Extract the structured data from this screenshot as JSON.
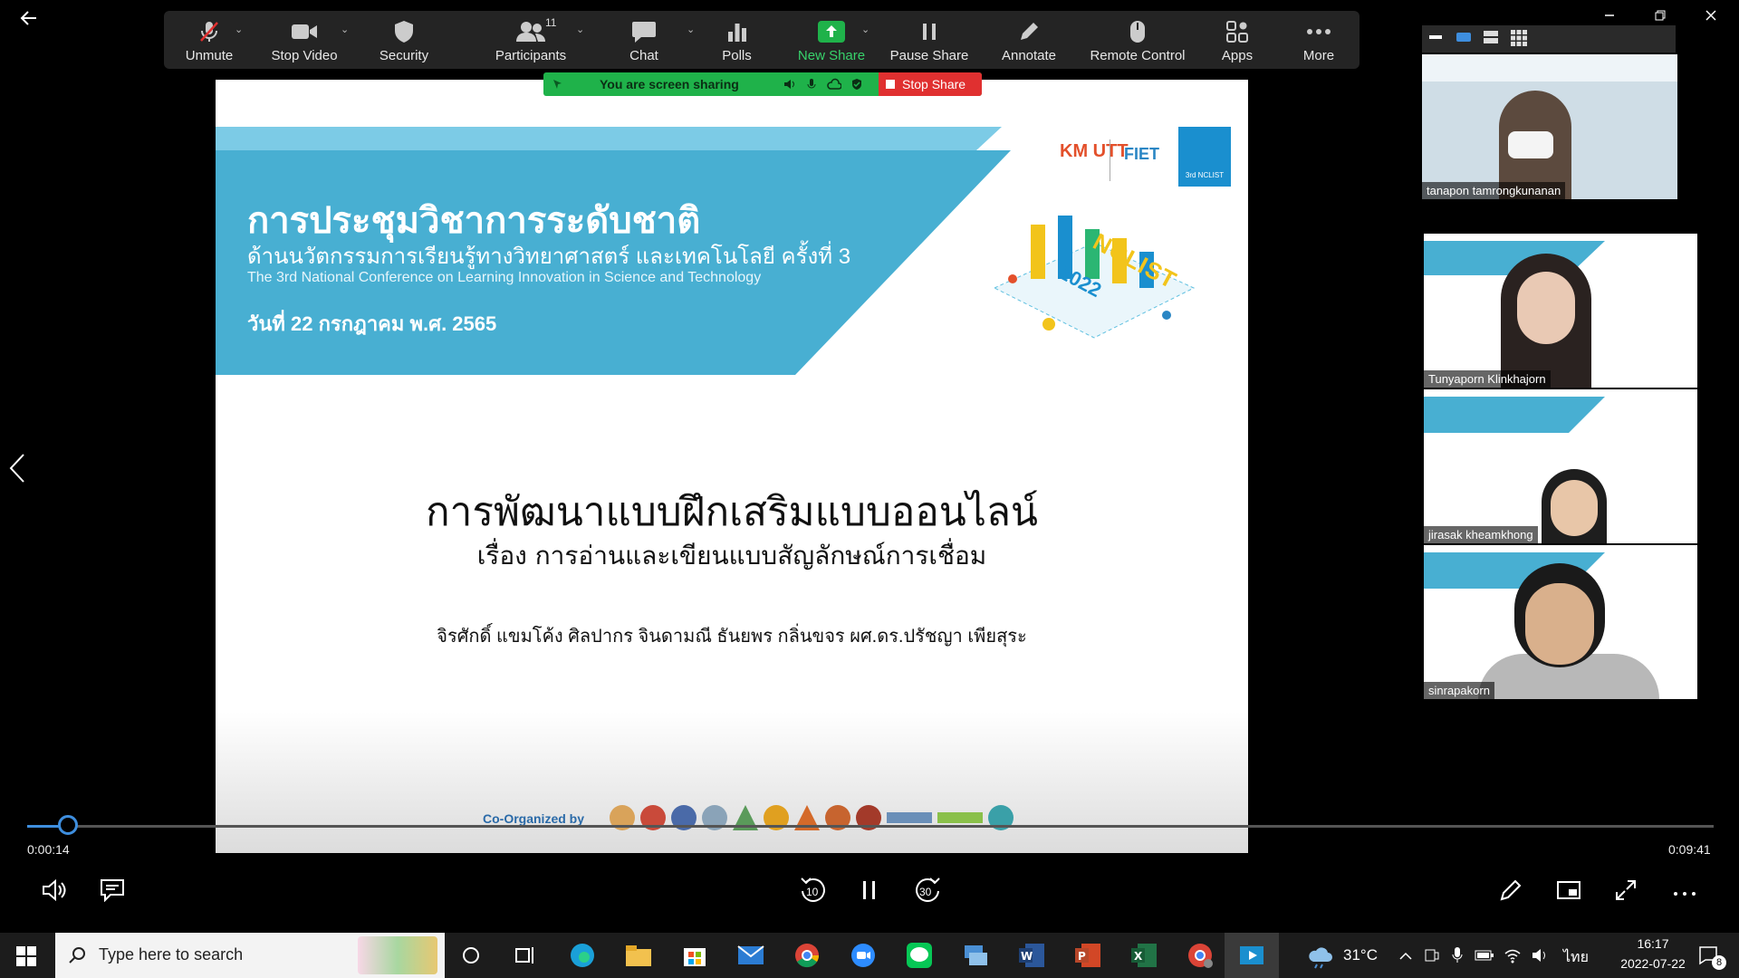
{
  "toolbar": {
    "unmute": "Unmute",
    "stop_video": "Stop Video",
    "security": "Security",
    "participants": "Participants",
    "participants_count": "11",
    "chat": "Chat",
    "polls": "Polls",
    "new_share": "New Share",
    "pause_share": "Pause Share",
    "annotate": "Annotate",
    "remote_control": "Remote Control",
    "apps": "Apps",
    "more": "More"
  },
  "share_banner": {
    "text": "You are screen sharing",
    "stop_label": "Stop Share"
  },
  "slide": {
    "banner_title": "การประชุมวิชาการระดับชาติ",
    "banner_subtitle": "ด้านนวัตกรรมการเรียนรู้ทางวิทยาศาสตร์ และเทคโนโลยี ครั้งที่ 3",
    "banner_english": "The 3rd National Conference on Learning Innovation in Science and Technology",
    "banner_date": "วันที่ 22 กรกฎาคม พ.ศ. 2565",
    "logo_kmutt": "KM UTT",
    "logo_fiet": "FIET",
    "logo_nclist": "3rd NCLIST",
    "art_text": "NCLIST",
    "art_year": "2022",
    "main_title": "การพัฒนาแบบฝึกเสริมแบบออนไลน์",
    "main_subtitle": "เรื่อง การอ่านและเขียนแบบสัญลักษณ์การเชื่อม",
    "authors": "จิรศักดิ์ แขมโค้ง ศิลปากร จินดามณี ธันยพร กลิ่นขจร ผศ.ดร.ปรัชญา เพียสุระ",
    "co_organized": "Co-Organized by"
  },
  "participants": [
    {
      "name": "tanapon tamrongkunanan"
    },
    {
      "name": "Tunyaporn Klinkhajorn"
    },
    {
      "name": "jirasak kheamkhong"
    },
    {
      "name": "sinrapakorn"
    }
  ],
  "player": {
    "current_time": "0:00:14",
    "total_time": "0:09:41",
    "progress_fraction": 0.024,
    "skip_back": "10",
    "skip_forward": "30"
  },
  "taskbar": {
    "search_placeholder": "Type here to search",
    "weather": "31°C",
    "language": "ไทย",
    "time": "16:17",
    "date": "2022-07-22",
    "notifications": "8"
  },
  "colors": {
    "share_green": "#1fb24a",
    "stop_red": "#e03030",
    "slide_blue": "#48afd2",
    "accent_blue": "#3e8ede"
  }
}
